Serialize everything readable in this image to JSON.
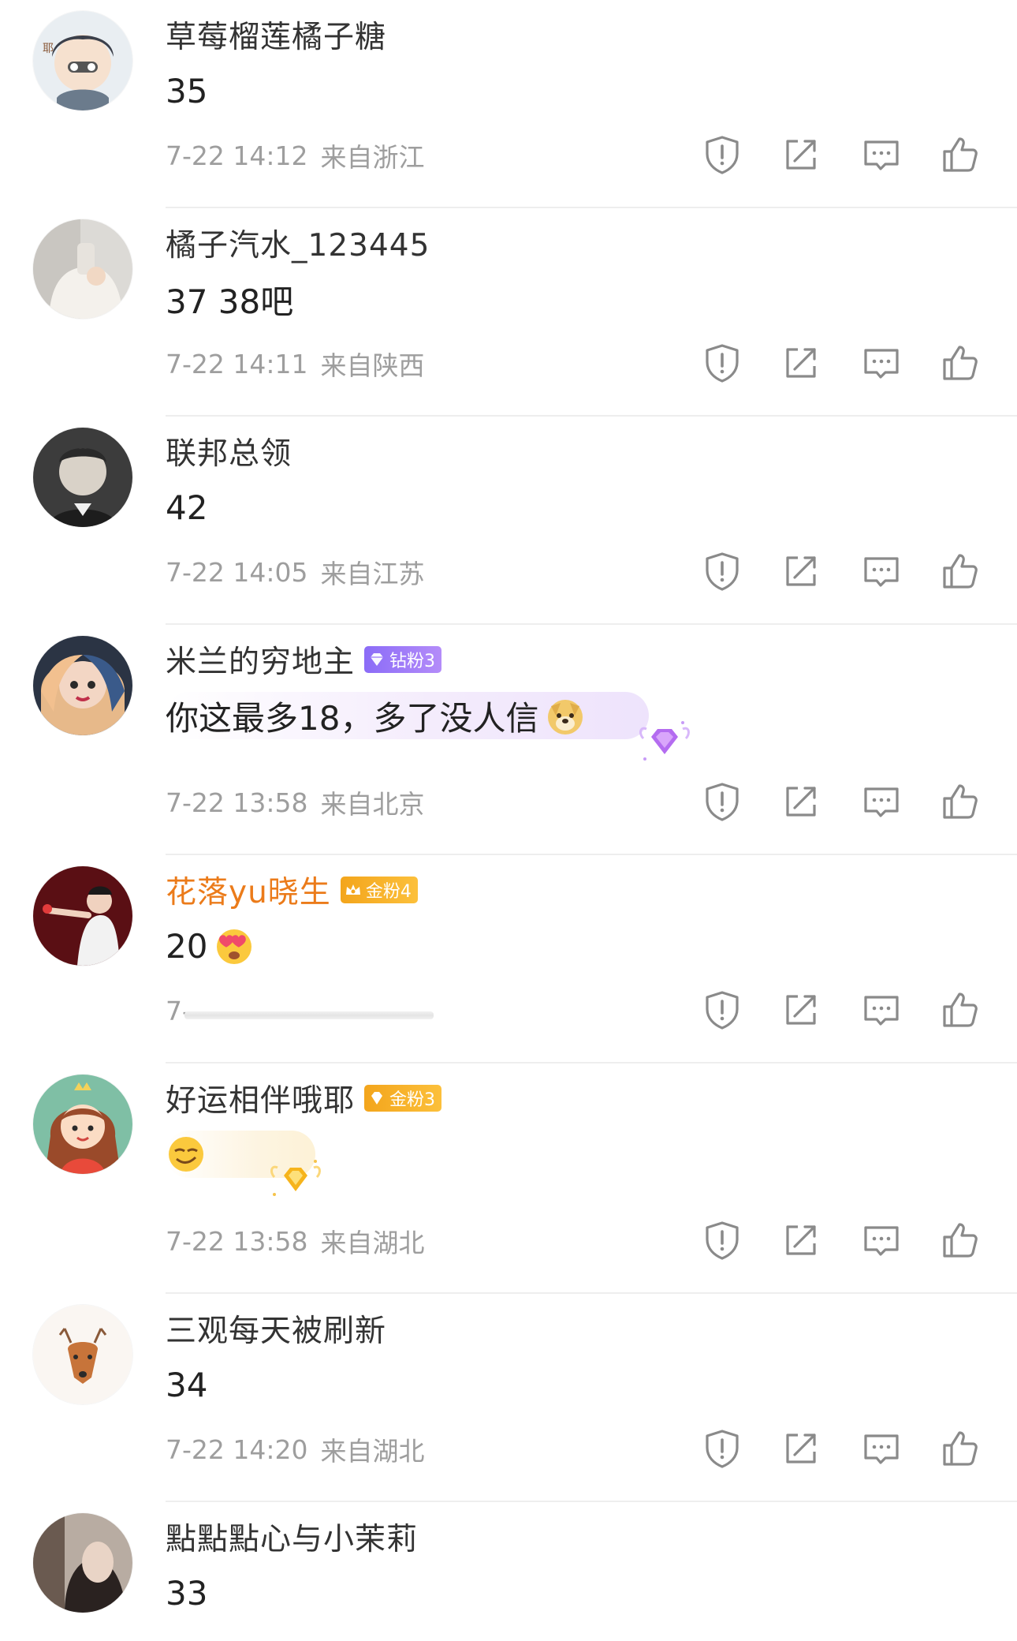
{
  "comments": [
    {
      "username": "草莓榴莲橘子糖",
      "text": "35",
      "time": "7-22 14:12",
      "location": "来自浙江"
    },
    {
      "username": "橘子汽水_123445",
      "text": "37 38吧",
      "time": "7-22 14:11",
      "location": "来自陕西"
    },
    {
      "username": "联邦总领",
      "text": "42",
      "time": "7-22 14:05",
      "location": "来自江苏"
    },
    {
      "username": "米兰的穷地主",
      "badge": "钻粉3",
      "text": "你这最多18，多了没人信",
      "emoji": "doge-emoji",
      "time": "7-22 13:58",
      "location": "来自北京"
    },
    {
      "username": "花落yu晓生",
      "badge": "金粉4",
      "text": "20",
      "emoji": "heart-eyes-emoji",
      "time": "7-"
    },
    {
      "username": "好运相伴哦耶",
      "badge": "金粉3",
      "emoji": "smirk-emoji",
      "time": "7-22 13:58",
      "location": "来自湖北"
    },
    {
      "username": "三观每天被刷新",
      "text": "34",
      "time": "7-22 14:20",
      "location": "来自湖北"
    },
    {
      "username": "點點點心与小茉莉",
      "text": "33"
    }
  ],
  "icons": {
    "report": "exclamation-shield-icon",
    "share": "share-arrow-icon",
    "reply": "comment-bubble-icon",
    "like": "thumbs-up-icon"
  },
  "colors": {
    "username": "#333333",
    "gold_username": "#eb7b1a",
    "meta_text": "#9e9e9e",
    "icon": "#8a8a8a",
    "diamond_badge": "#8b6cf7",
    "gold_badge": "#f3a51c",
    "divider": "#eeeeee"
  }
}
